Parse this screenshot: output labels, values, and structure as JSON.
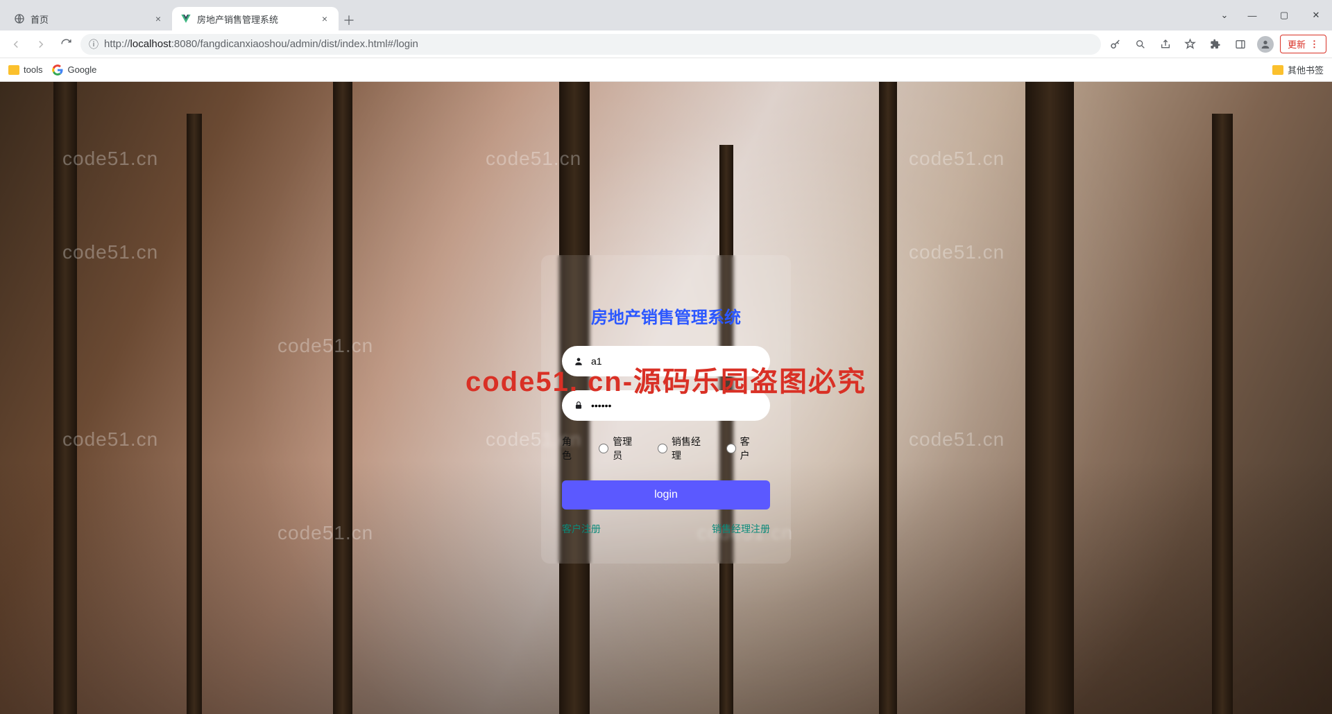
{
  "browser": {
    "tabs": [
      {
        "title": "首页",
        "active": false
      },
      {
        "title": "房地产销售管理系统",
        "active": true
      }
    ],
    "url_host": "localhost",
    "url_port": ":8080",
    "url_path": "/fangdicanxiaoshou/admin/dist/index.html#/login",
    "url_prefix": "http://",
    "update_label": "更新",
    "bookmarks": {
      "tools": "tools",
      "google": "Google",
      "other": "其他书签"
    }
  },
  "login": {
    "title": "房地产销售管理系统",
    "username_value": "a1",
    "password_value": "••••••",
    "role_label": "角色",
    "roles": [
      "管理员",
      "销售经理",
      "客户"
    ],
    "button": "login",
    "register_customer": "客户注册",
    "register_manager": "销售经理注册"
  },
  "watermarks": {
    "site": "code51.cn",
    "big": "code51. cn-源码乐园盗图必究"
  }
}
